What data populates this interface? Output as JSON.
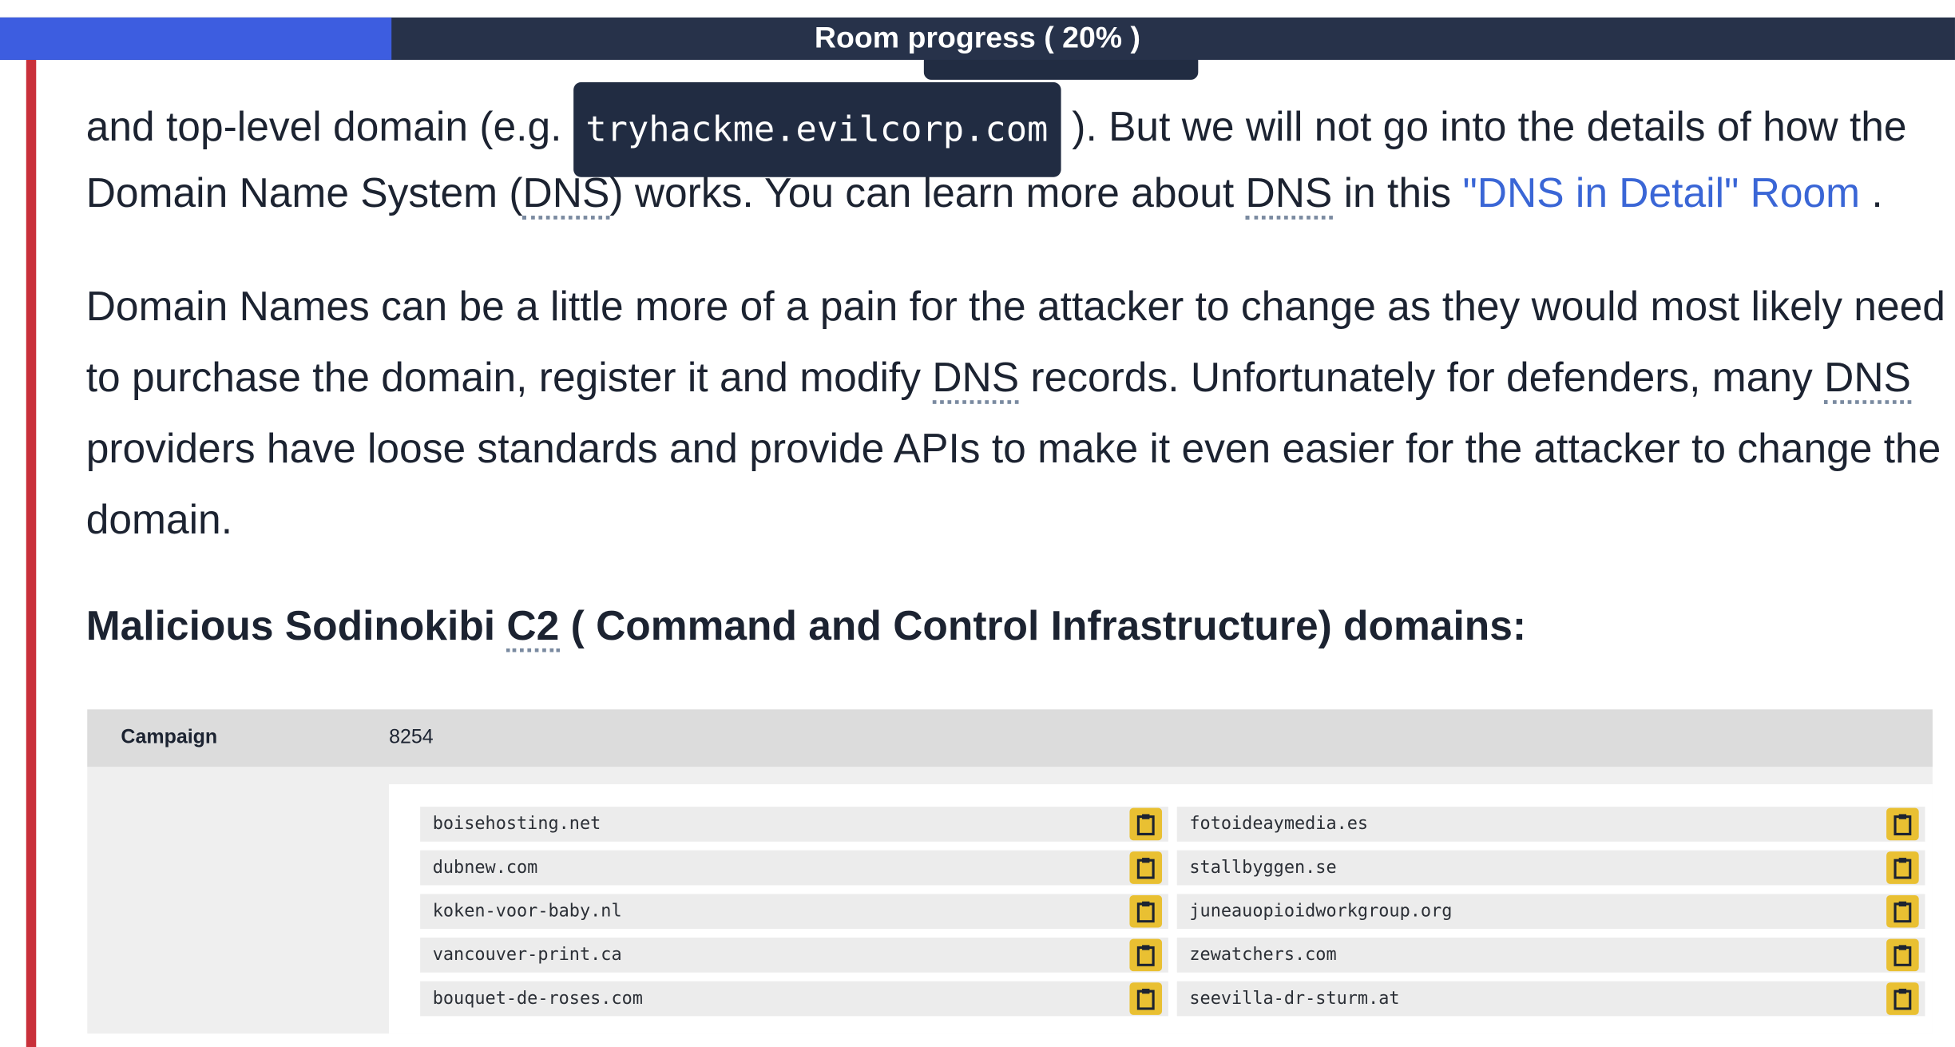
{
  "progress": {
    "label": "Room progress ( 20% )",
    "percent": 20
  },
  "paragraph1": {
    "prefix": "and top-level domain (e.g. ",
    "code": "tryhackme.evilcorp.com",
    "suffix": " ). But we will not go into the details of how the",
    "line2_a": "Domain Name System (",
    "line2_dns": "DNS",
    "line2_b": ") works. You can learn more about ",
    "line2_dns2": "DNS",
    "line2_c": " in this ",
    "link": "\"DNS in Detail\" Room",
    "line2_end": " ."
  },
  "paragraph2": {
    "l1": "Domain Names can be a little more of a pain for the attacker to change as they would most likely need",
    "l2a": "to purchase the domain, register it and modify ",
    "l2dns": "DNS",
    "l2b": " records. Unfortunately for defenders, many ",
    "l2dns2": "DNS",
    "l3": "providers have loose standards and provide APIs to make it even easier for the attacker to change the",
    "l4": "domain."
  },
  "heading": {
    "a": "Malicious  Sodinokibi  ",
    "c2": "C2",
    "b": " ( Command and Control Infrastructure)  domains:"
  },
  "table": {
    "key": "Campaign",
    "value": "8254",
    "domains_left": [
      "boisehosting.net",
      "dubnew.com",
      "koken-voor-baby.nl",
      "vancouver-print.ca",
      "bouquet-de-roses.com"
    ],
    "domains_right": [
      "fotoideaymedia.es",
      "stallbyggen.se",
      "juneauopioidworkgroup.org",
      "zewatchers.com",
      "seevilla-dr-sturm.at"
    ]
  },
  "icons": {
    "copy": "clipboard-icon"
  },
  "colors": {
    "accent": "#3d5de0",
    "progress_bg": "#27324a",
    "rule": "#c9303a",
    "copy_btn": "#e9c032",
    "link": "#3a66d6"
  }
}
